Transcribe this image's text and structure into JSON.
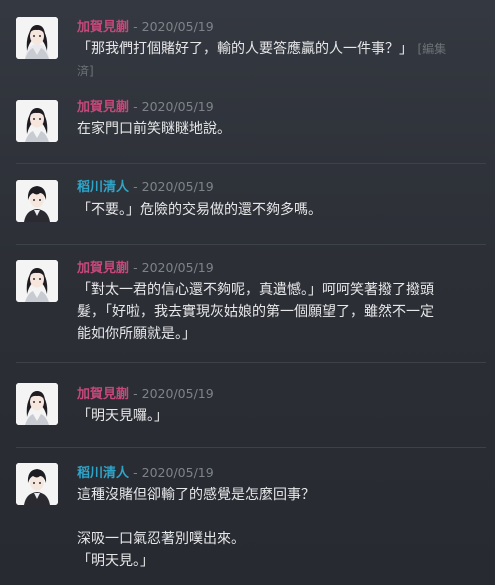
{
  "messages": [
    {
      "author": "加賀見蒯",
      "timestamp": "- 2020/05/19",
      "lines": [
        "「那我們打個賭好了，輸的人要答應贏的人一件事？」"
      ],
      "edited_label_part1": "[編集",
      "edited_label_part2": "済]"
    },
    {
      "author": "加賀見蒯",
      "timestamp": "- 2020/05/19",
      "lines": [
        "在家門口前笑瞇瞇地說。"
      ]
    },
    {
      "author": "稻川清人",
      "timestamp": "- 2020/05/19",
      "lines": [
        "「不要。」危險的交易做的還不夠多嗎。"
      ]
    },
    {
      "author": "加賀見蒯",
      "timestamp": "- 2020/05/19",
      "lines": [
        "「對太一君的信心還不夠呢，真遺憾。」呵呵笑著撥了撥頭",
        "髮，「好啦，我去實現灰姑娘的第一個願望了，雖然不一定",
        "能如你所願就是。」"
      ]
    },
    {
      "author": "加賀見蒯",
      "timestamp": "- 2020/05/19",
      "lines": [
        "「明天見囉。」"
      ]
    },
    {
      "author": "稻川清人",
      "timestamp": "- 2020/05/19",
      "lines": [
        "這種沒賭但卻輸了的感覺是怎麼回事？"
      ],
      "lines_after_gap": [
        "深吸一口氣忍著別噗出來。",
        "「明天見。」"
      ]
    }
  ]
}
